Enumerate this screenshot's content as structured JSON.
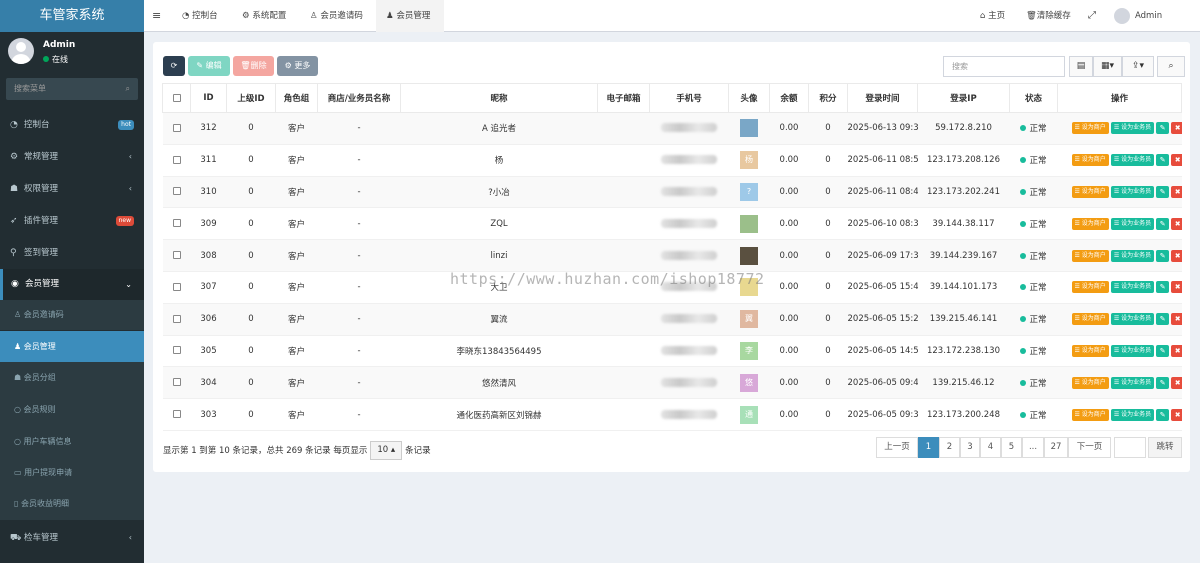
{
  "app": {
    "title": "车管家系统"
  },
  "user": {
    "name": "Admin",
    "status": "在线"
  },
  "sidebar": {
    "search_placeholder": "搜索菜单",
    "items": [
      {
        "label": "控制台",
        "badge": "hot",
        "badge_color": "#3c8dbc"
      },
      {
        "label": "常规管理"
      },
      {
        "label": "权限管理"
      },
      {
        "label": "插件管理",
        "badge": "new",
        "badge_color": "#dd4b39"
      },
      {
        "label": "签到管理"
      },
      {
        "label": "会员管理"
      }
    ],
    "subitems": [
      {
        "label": "会员邀请码"
      },
      {
        "label": "会员管理"
      },
      {
        "label": "会员分组"
      },
      {
        "label": "会员规则"
      },
      {
        "label": "用户车辆信息"
      },
      {
        "label": "用户提现申请"
      },
      {
        "label": "会员收益明细"
      }
    ],
    "bottom_item": {
      "label": "检车管理"
    }
  },
  "topbar": {
    "tabs": [
      {
        "label": "控制台"
      },
      {
        "label": "系统配置"
      },
      {
        "label": "会员邀请码"
      },
      {
        "label": "会员管理"
      }
    ],
    "right": {
      "home": "主页",
      "clear_cache": "清除缓存",
      "user": "Admin"
    }
  },
  "toolbar": {
    "edit": "编辑",
    "delete": "删除",
    "more": "更多",
    "search_placeholder": "搜索"
  },
  "table": {
    "headers": [
      "ID",
      "上级ID",
      "角色组",
      "商店/业务员名称",
      "昵称",
      "电子邮箱",
      "手机号",
      "头像",
      "余额",
      "积分",
      "登录时间",
      "登录IP",
      "状态",
      "操作"
    ],
    "rows": [
      {
        "id": "312",
        "parent": "0",
        "role": "客户",
        "shop": "-",
        "nickname": "A 追光者",
        "email": "",
        "avatar": "",
        "avatar_color": "#7aa7c7",
        "balance": "0.00",
        "points": "0",
        "login_time": "2025-06-13 09:30:11",
        "ip": "59.172.8.210",
        "status": "正常"
      },
      {
        "id": "311",
        "parent": "0",
        "role": "客户",
        "shop": "-",
        "nickname": "杨",
        "email": "",
        "avatar": "杨",
        "avatar_color": "#e8c8a0",
        "balance": "0.00",
        "points": "0",
        "login_time": "2025-06-11 08:57:27",
        "ip": "123.173.208.126",
        "status": "正常"
      },
      {
        "id": "310",
        "parent": "0",
        "role": "客户",
        "shop": "-",
        "nickname": "?小冶",
        "email": "",
        "avatar": "?",
        "avatar_color": "#9ec9e8",
        "balance": "0.00",
        "points": "0",
        "login_time": "2025-06-11 08:47:34",
        "ip": "123.173.202.241",
        "status": "正常"
      },
      {
        "id": "309",
        "parent": "0",
        "role": "客户",
        "shop": "-",
        "nickname": "ZQL",
        "email": "",
        "avatar": "",
        "avatar_color": "#9bbf8a",
        "balance": "0.00",
        "points": "0",
        "login_time": "2025-06-10 08:35:19",
        "ip": "39.144.38.117",
        "status": "正常"
      },
      {
        "id": "308",
        "parent": "0",
        "role": "客户",
        "shop": "-",
        "nickname": "linzi",
        "email": "",
        "avatar": "",
        "avatar_color": "#5a5040",
        "balance": "0.00",
        "points": "0",
        "login_time": "2025-06-09 17:31:20",
        "ip": "39.144.239.167",
        "status": "正常"
      },
      {
        "id": "307",
        "parent": "0",
        "role": "客户",
        "shop": "-",
        "nickname": "大卫",
        "email": "",
        "avatar": "",
        "avatar_color": "#e8d890",
        "balance": "0.00",
        "points": "0",
        "login_time": "2025-06-05 15:43:10",
        "ip": "39.144.101.173",
        "status": "正常"
      },
      {
        "id": "306",
        "parent": "0",
        "role": "客户",
        "shop": "-",
        "nickname": "翼流",
        "email": "",
        "avatar": "翼",
        "avatar_color": "#e0b8a0",
        "balance": "0.00",
        "points": "0",
        "login_time": "2025-06-05 15:29:46",
        "ip": "139.215.46.141",
        "status": "正常"
      },
      {
        "id": "305",
        "parent": "0",
        "role": "客户",
        "shop": "-",
        "nickname": "李晓东13843564495",
        "email": "",
        "avatar": "李",
        "avatar_color": "#a8d8a0",
        "balance": "0.00",
        "points": "0",
        "login_time": "2025-06-05 14:52:42",
        "ip": "123.172.238.130",
        "status": "正常"
      },
      {
        "id": "304",
        "parent": "0",
        "role": "客户",
        "shop": "-",
        "nickname": "悠然清风",
        "email": "",
        "avatar": "悠",
        "avatar_color": "#d8a8d8",
        "balance": "0.00",
        "points": "0",
        "login_time": "2025-06-05 09:41:32",
        "ip": "139.215.46.12",
        "status": "正常"
      },
      {
        "id": "303",
        "parent": "0",
        "role": "客户",
        "shop": "-",
        "nickname": "通化医药高新区刘锦赫",
        "email": "",
        "avatar": "通",
        "avatar_color": "#a8e0b8",
        "balance": "0.00",
        "points": "0",
        "login_time": "2025-06-05 09:35:05",
        "ip": "123.173.200.248",
        "status": "正常"
      }
    ],
    "op_labels": {
      "set_merchant": "设为商户",
      "set_salesman": "设为业务员"
    }
  },
  "footer": {
    "text_before": "显示第 1 到第 10 条记录，总共 269 条记录 每页显示",
    "page_size": "10",
    "text_after": "条记录"
  },
  "pagination": {
    "prev": "上一页",
    "pages": [
      "1",
      "2",
      "3",
      "4",
      "5",
      "...",
      "27"
    ],
    "next": "下一页",
    "jump": "跳转",
    "current": "1"
  },
  "watermark": "https://www.huzhan.com/ishop18772",
  "colors": {
    "sidebar_bg": "#222d32",
    "accent": "#3c8dbc",
    "green": "#18bc9c",
    "orange": "#f39c12",
    "red": "#e74c3c"
  }
}
